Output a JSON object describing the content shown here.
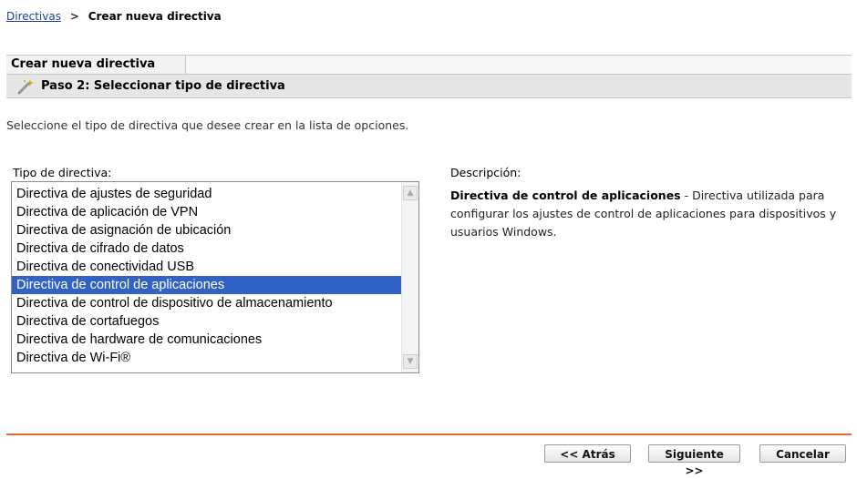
{
  "breadcrumb": {
    "parent": "Directivas",
    "separator": ">",
    "current": "Crear nueva directiva"
  },
  "wizard": {
    "tab_label": "Crear nueva directiva",
    "step_title": "Paso 2: Seleccionar tipo de directiva",
    "step_icon": "wand-icon"
  },
  "instructions": "Seleccione el tipo de directiva que desee crear en la lista de opciones.",
  "policy_type": {
    "label": "Tipo de directiva:",
    "selected_index": 5,
    "options": [
      "Directiva de ajustes de seguridad",
      "Directiva de aplicación de VPN",
      "Directiva de asignación de ubicación",
      "Directiva de cifrado de datos",
      "Directiva de conectividad USB",
      "Directiva de control de aplicaciones",
      "Directiva de control de dispositivo de almacenamiento",
      "Directiva de cortafuegos",
      "Directiva de hardware de comunicaciones",
      "Directiva de Wi-Fi®"
    ]
  },
  "description": {
    "label": "Descripción:",
    "title": "Directiva de control de aplicaciones",
    "body": " - Directiva utilizada para configurar los ajustes de control de aplicaciones para dispositivos y usuarios Windows."
  },
  "buttons": {
    "back": "<< Atrás",
    "next": "Siguiente >>",
    "cancel": "Cancelar"
  },
  "colors": {
    "accent_divider": "#e36b2c",
    "selection": "#3163c7",
    "link": "#1a3f9e"
  }
}
